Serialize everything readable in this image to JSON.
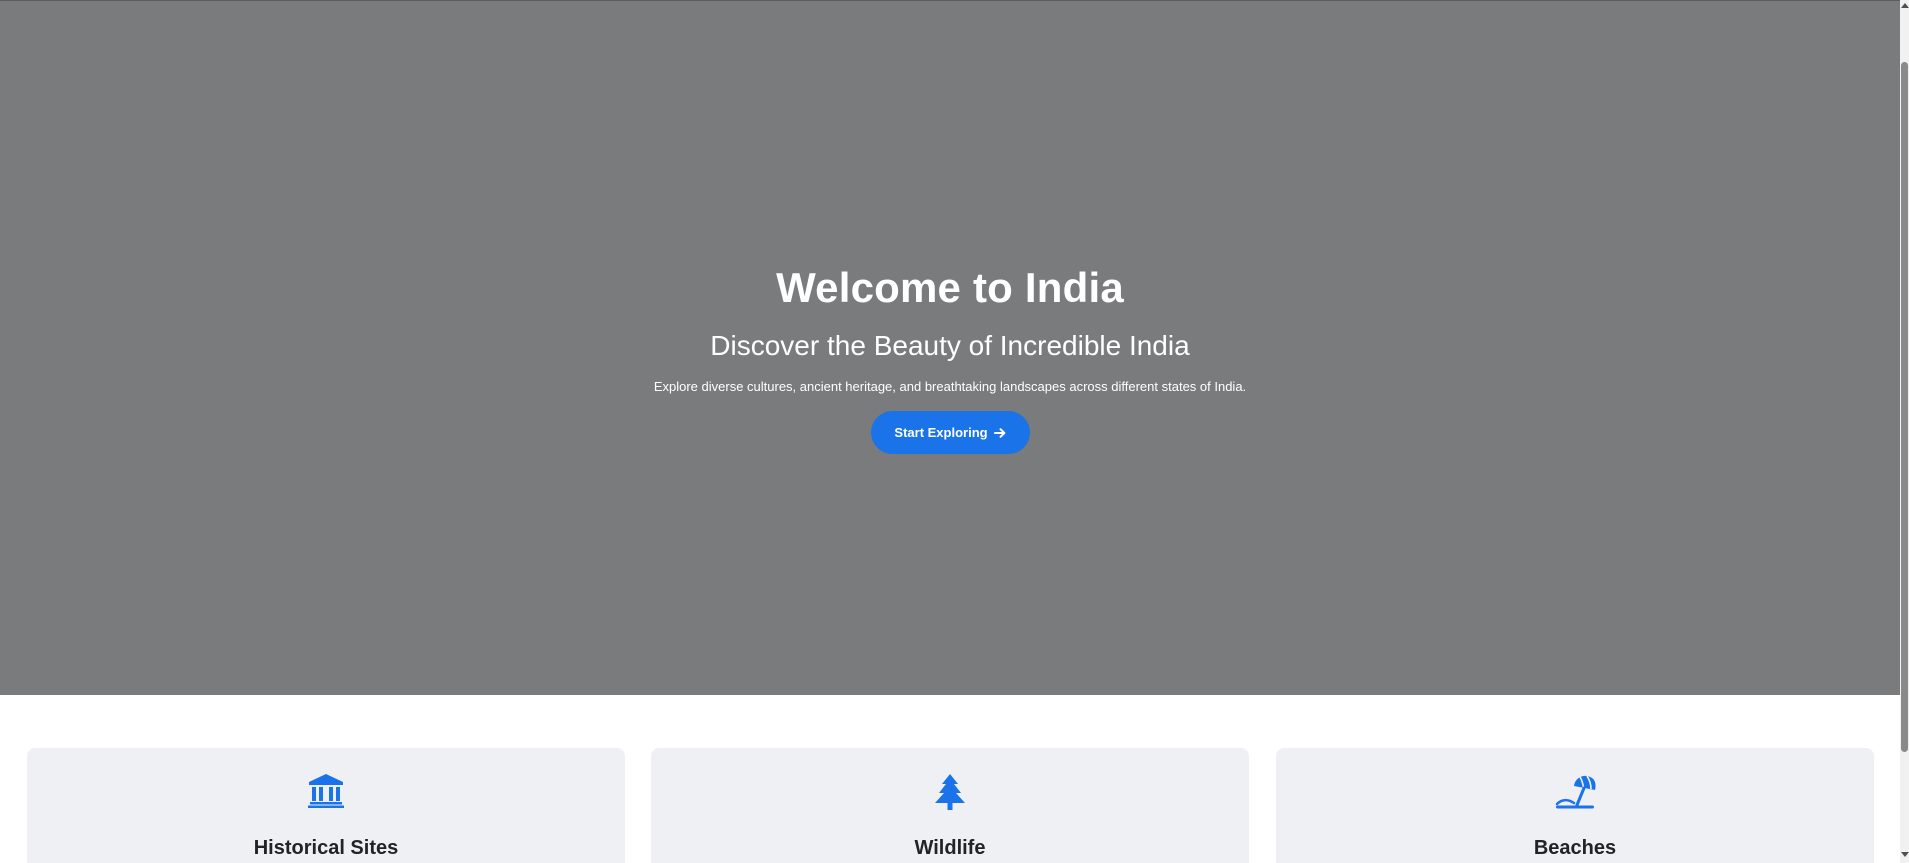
{
  "hero": {
    "title": "Welcome to India",
    "subtitle": "Discover the Beauty of Incredible India",
    "description": "Explore diverse cultures, ancient heritage, and breathtaking landscapes across different states of India.",
    "cta_label": "Start Exploring",
    "cta_icon": "arrow-right-icon"
  },
  "categories": [
    {
      "title": "Historical Sites",
      "icon": "landmark-icon"
    },
    {
      "title": "Wildlife",
      "icon": "tree-icon"
    },
    {
      "title": "Beaches",
      "icon": "beach-umbrella-icon"
    }
  ],
  "colors": {
    "hero_background": "#7a7b7d",
    "accent": "#1a73e8",
    "card_background": "#eff0f3",
    "heading_text": "#222326"
  }
}
